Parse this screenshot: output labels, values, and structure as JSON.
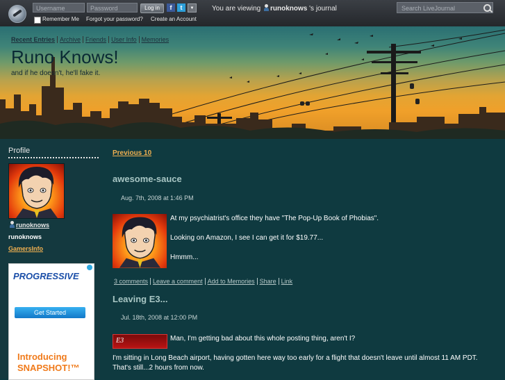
{
  "topbar": {
    "username_placeholder": "Username",
    "password_placeholder": "Password",
    "login_label": "Log in",
    "facebook": "f",
    "twitter": "t",
    "more": "▼",
    "remember_me": "Remember Me",
    "forgot_password": "Forgot your password?",
    "create_account": "Create an Account",
    "viewing_prefix": "You are viewing",
    "viewing_user": "runoknows",
    "viewing_suffix": "'s journal",
    "search_placeholder": "Search LiveJournal"
  },
  "header": {
    "nav": [
      "Recent Entries",
      "Archive",
      "Friends",
      "User Info",
      "Memories"
    ],
    "title": "Runo Knows!",
    "subtitle": "and if he doesn't, he'll fake it."
  },
  "sidebar": {
    "heading": "Profile",
    "username": "runoknows",
    "name": "runoknows",
    "gamers_link": "GamersInfo",
    "ad": {
      "logo": "PROGRESSIVE",
      "button": "Get Started",
      "line1": "Introducing",
      "line2": "SNAPSHOT!™"
    }
  },
  "main": {
    "previous": "Previous 10",
    "entries": [
      {
        "title": "awesome-sauce",
        "date": "Aug. 7th, 2008 at 1:46 PM",
        "paragraphs": [
          "At my psychiatrist's office they have \"The Pop-Up Book of Phobias\".",
          "Looking on Amazon, I see I can get it for $19.77...",
          "Hmmm..."
        ],
        "links": [
          "3 comments",
          "Leave a comment",
          "Add to Memories",
          "Share",
          "Link"
        ]
      },
      {
        "title": "Leaving E3...",
        "date": "Jul. 18th, 2008 at 12:00 PM",
        "image_text": "E3",
        "paragraphs": [
          "Man, I'm getting bad about this whole posting thing, aren't I?",
          "I'm sitting in Long Beach airport, having gotten here way too early for a flight that doesn't leave until almost 11 AM PDT.",
          "That's still...2 hours from now."
        ]
      }
    ]
  },
  "colors": {
    "background": "#0f3a40",
    "link_accent": "#f0b050",
    "title_text": "#a8c6c4"
  }
}
